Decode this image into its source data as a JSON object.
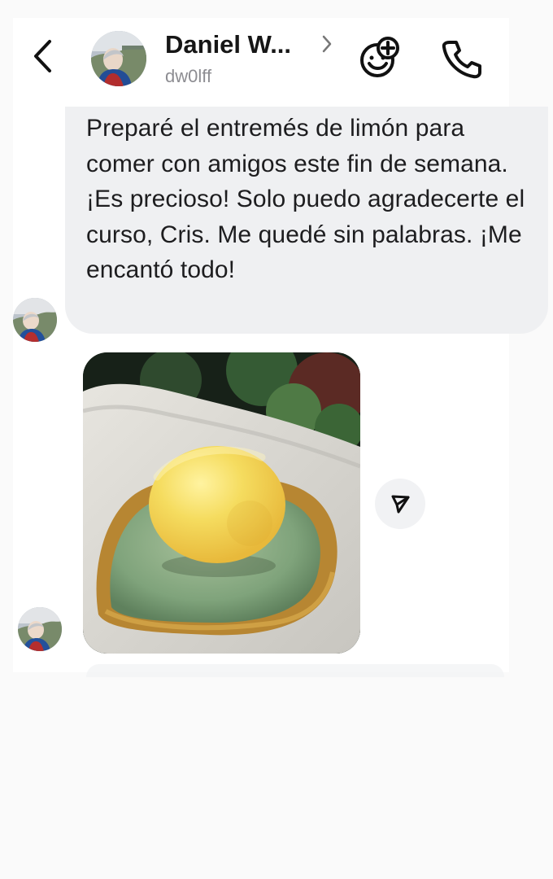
{
  "header": {
    "contact_name": "Daniel W...",
    "username": "dw0lff",
    "icons": {
      "back": "chevron-left-icon",
      "profile": "chevron-right-icon",
      "reaction": "emoji-add-icon",
      "call": "phone-icon"
    }
  },
  "messages": [
    {
      "type": "text",
      "text": "Preparé el entremés de limón para comer con amigos este fin de semana. ¡Es precioso! Solo puedo agradecerte el curso, Cris. Me quedé sin palabras. ¡Me encantó todo!"
    },
    {
      "type": "image",
      "icon": "share-icon"
    }
  ],
  "colors": {
    "background": "#fafafa",
    "panel": "#ffffff",
    "bubble": "#eff0f2",
    "text": "#1d1d1f",
    "secondary_text": "#8d8d92"
  }
}
